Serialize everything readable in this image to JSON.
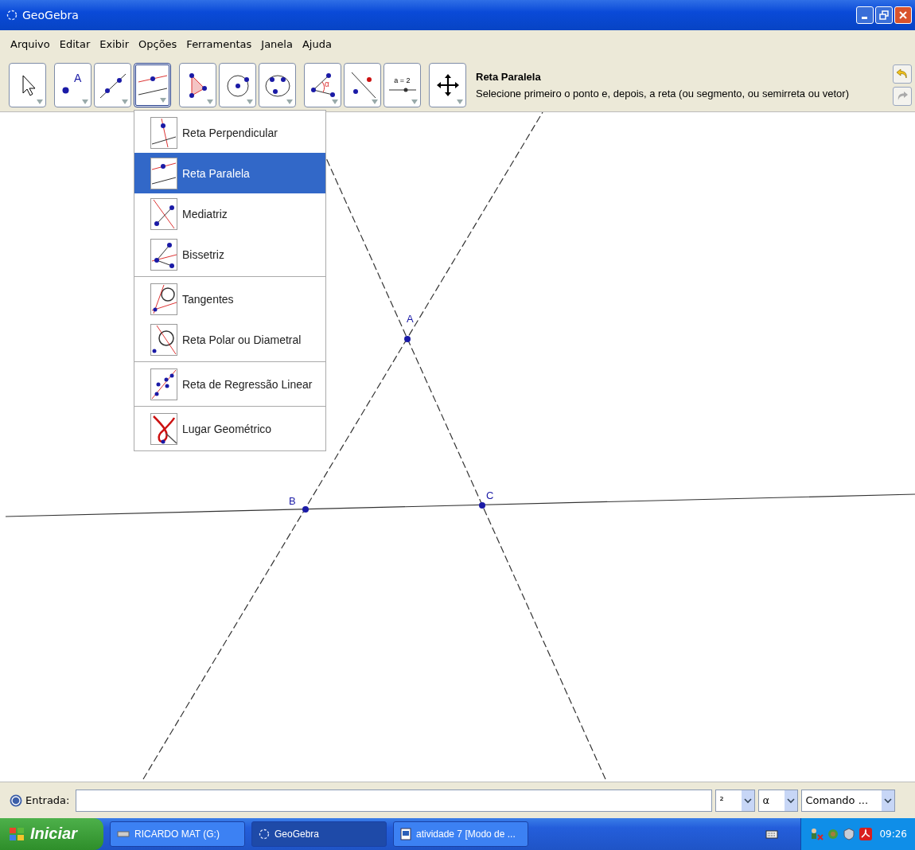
{
  "window": {
    "title": "GeoGebra"
  },
  "menu": [
    "Arquivo",
    "Editar",
    "Exibir",
    "Opções",
    "Ferramentas",
    "Janela",
    "Ajuda"
  ],
  "toolbar": {
    "groups": [
      [
        {
          "kind": "move",
          "selected": false
        }
      ],
      [
        {
          "kind": "point",
          "selected": false,
          "label": "A"
        },
        {
          "kind": "line",
          "selected": false
        },
        {
          "kind": "parallel",
          "selected": true
        }
      ],
      [
        {
          "kind": "polygon",
          "selected": false
        },
        {
          "kind": "circle",
          "selected": false
        },
        {
          "kind": "conic",
          "selected": false
        }
      ],
      [
        {
          "kind": "angle",
          "selected": false,
          "label": "α"
        },
        {
          "kind": "reflect",
          "selected": false
        },
        {
          "kind": "slider",
          "selected": false,
          "label": "a = 2"
        }
      ],
      [
        {
          "kind": "move-view",
          "selected": false
        }
      ]
    ],
    "tool_name": "Reta Paralela",
    "tool_help": "Selecione primeiro o ponto e, depois, a reta (ou segmento, ou semirreta ou vetor)"
  },
  "tool_menu": [
    [
      {
        "label": "Reta Perpendicular",
        "kind": "perpendicular",
        "selected": false
      },
      {
        "label": "Reta Paralela",
        "kind": "parallel",
        "selected": true
      },
      {
        "label": "Mediatriz",
        "kind": "bisector",
        "selected": false
      },
      {
        "label": "Bissetriz",
        "kind": "angle-bisector",
        "selected": false
      }
    ],
    [
      {
        "label": "Tangentes",
        "kind": "tangent",
        "selected": false
      },
      {
        "label": "Reta Polar ou Diametral",
        "kind": "polar",
        "selected": false
      }
    ],
    [
      {
        "label": "Reta de Regressão Linear",
        "kind": "regression",
        "selected": false
      }
    ],
    [
      {
        "label": "Lugar Geométrico",
        "kind": "locus",
        "selected": false
      }
    ]
  ],
  "points": [
    {
      "label": "A"
    },
    {
      "label": "B"
    },
    {
      "label": "C"
    }
  ],
  "input_bar": {
    "label": "Entrada:",
    "selectors": [
      "²",
      "α",
      "Comando ..."
    ]
  },
  "taskbar": {
    "start": "Iniciar",
    "tasks": [
      {
        "label": "RICARDO MAT (G:)",
        "kind": "drive",
        "selected": false
      },
      {
        "label": "GeoGebra",
        "kind": "app",
        "selected": true
      },
      {
        "label": "atividade 7 [Modo de ...",
        "kind": "document",
        "selected": false
      }
    ],
    "time": "09:26"
  }
}
